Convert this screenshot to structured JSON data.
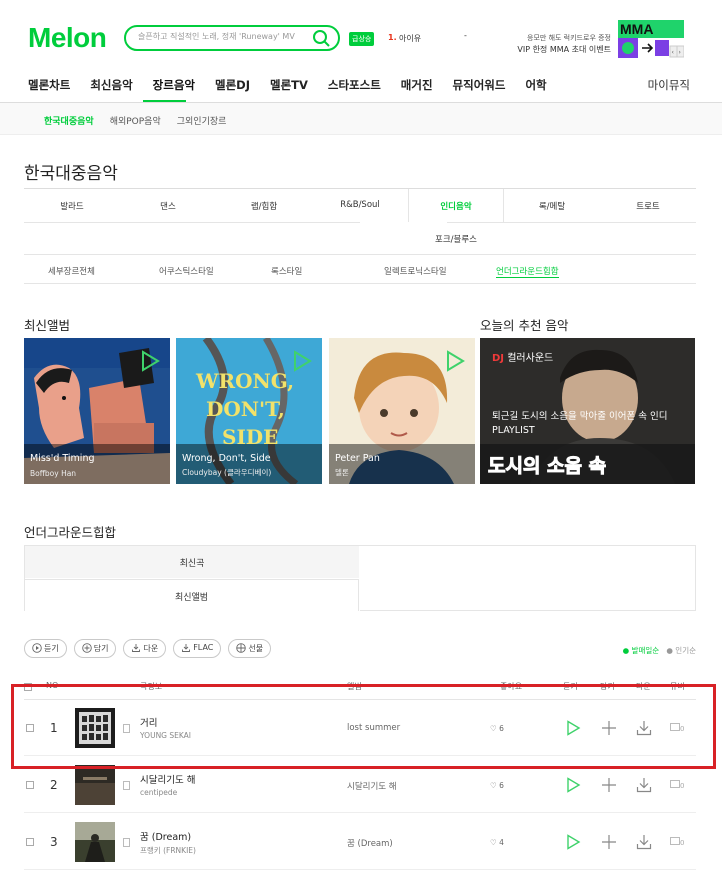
{
  "header": {
    "logo": "Melon",
    "search_placeholder": "슬픈하고 직설적인 노래, 정재 'Runeway' MV",
    "realtime_badge": "급상승",
    "realtime_rank": "1.",
    "realtime_title": "아이유",
    "realtime_dash": "-",
    "promo_line1": "응모만 해도 럭키드로우 증정",
    "promo_line2": "VIP 한정 MMA 초대 이벤트",
    "mma_label": "MMA"
  },
  "gnb": {
    "items": [
      "멜론차트",
      "최신음악",
      "장르음악",
      "멜론DJ",
      "멜론TV",
      "스타포스트",
      "매거진",
      "뮤직어워드",
      "어학"
    ],
    "mymusic": "마이뮤직"
  },
  "subnav": [
    "한국대중음악",
    "해외POP음악",
    "그외인기장르"
  ],
  "page_title": "한국대중음악",
  "genres": {
    "row1": [
      "발라드",
      "댄스",
      "랩/힙합",
      "R&B/Soul",
      "인디음악",
      "록/메탈",
      "트로트"
    ],
    "row2": "포크/블루스",
    "details": [
      "세부장르전체",
      "어쿠스틱스타일",
      "록스타일",
      "일렉트로닉스타일",
      "언더그라운드힙합"
    ]
  },
  "new_albums": {
    "title": "최신앨범",
    "items": [
      {
        "title": "Miss'd Timing",
        "artist": "Boffboy Han"
      },
      {
        "title": "Wrong, Don't, Side",
        "artist": "Cloudybay (클라우디베이)",
        "cover_text": "WRONG, DON'T, SIDE"
      },
      {
        "title": "Peter Pan",
        "artist": "델론"
      }
    ]
  },
  "recommend": {
    "title": "오늘의 추천 음악",
    "dj_label": "DJ",
    "category": "컬러사운드",
    "desc": "퇴근길 도시의 소음을 막아줄 이어폰 속 인디 PLAYLIST",
    "big_text": "도시의 소음 속"
  },
  "underground": {
    "title": "언더그라운드힙합",
    "tab1": "최신곡",
    "tab2": "최신앨범"
  },
  "actions": [
    "듣기",
    "담기",
    "다운",
    "FLAC",
    "선물"
  ],
  "sort": {
    "on": "● 발매일순",
    "off": "● 인기순"
  },
  "table_headers": [
    "NO",
    "곡정보",
    "앨범",
    "좋아요",
    "듣기",
    "담기",
    "다운",
    "뮤비"
  ],
  "songs": [
    {
      "rank": "1",
      "title": "거리",
      "artist": "YOUNG SEKAI",
      "album": "lost summer",
      "likes": "♡ 6",
      "mv": "0"
    },
    {
      "rank": "2",
      "title": "시달리기도 해",
      "artist": "centipede",
      "album": "시달리기도 해",
      "likes": "♡ 6",
      "mv": "0"
    },
    {
      "rank": "3",
      "title": "꿈 (Dream)",
      "artist": "프랭키 (FRNKIE)",
      "album": "꿈 (Dream)",
      "likes": "♡ 4",
      "mv": "0"
    }
  ]
}
